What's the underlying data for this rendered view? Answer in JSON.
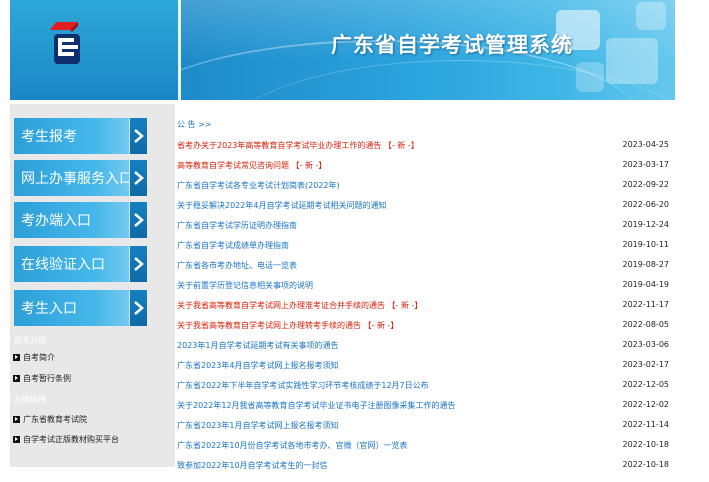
{
  "header": {
    "site_title": "广东省自学考试管理系统"
  },
  "sidebar": {
    "nav": [
      {
        "label": "考生报考"
      },
      {
        "label": "网上办事服务入口"
      },
      {
        "label": "考办端入口"
      },
      {
        "label": "在线验证入口"
      },
      {
        "label": "考生入口"
      }
    ],
    "sections": [
      {
        "heading": "自考介绍",
        "links": [
          "自考简介",
          "自考暂行条例"
        ]
      },
      {
        "heading": "友情链接",
        "links": [
          "广东省教育考试院",
          "自学考试正版教材购买平台"
        ]
      }
    ]
  },
  "notices": {
    "heading": "公 告 >>",
    "items": [
      {
        "title": "省考办关于2023年高等教育自学考试毕业办理工作的通告 【- 新 -】",
        "date": "2023-04-25",
        "highlight": true
      },
      {
        "title": "高等教育自学考试常见咨询问题 【- 新 -】",
        "date": "2023-03-17",
        "highlight": true
      },
      {
        "title": "广东省自学考试各专业考试计划简表(2022年)",
        "date": "2022-09-22",
        "highlight": false
      },
      {
        "title": "关于稳妥解决2022年4月自学考试延期考试相关问题的通知",
        "date": "2022-06-20",
        "highlight": false
      },
      {
        "title": "广东省自学考试学历证明办理指南",
        "date": "2019-12-24",
        "highlight": false
      },
      {
        "title": "广东省自学考试成绩单办理指南",
        "date": "2019-10-11",
        "highlight": false
      },
      {
        "title": "广东省各市考办地址、电话一览表",
        "date": "2019-08-27",
        "highlight": false
      },
      {
        "title": "关于前置学历登记信息相关事项的说明",
        "date": "2019-04-19",
        "highlight": false
      },
      {
        "title": "关于我省高等教育自学考试网上办理准考证合并手续的通告 【- 新 -】",
        "date": "2022-11-17",
        "highlight": true
      },
      {
        "title": "关于我省高等教育自学考试网上办理转考手续的通告 【- 新 -】",
        "date": "2022-08-05",
        "highlight": true
      },
      {
        "title": "2023年1月自学考试延期考试有关事项的通告",
        "date": "2023-03-06",
        "highlight": false
      },
      {
        "title": "广东省2023年4月自学考试网上报名报考须知",
        "date": "2023-02-17",
        "highlight": false
      },
      {
        "title": "广东省2022年下半年自学考试实践性学习环节考核成绩于12月7日公布",
        "date": "2022-12-05",
        "highlight": false
      },
      {
        "title": "关于2022年12月我省高等教育自学考试毕业证书电子注册图像采集工作的通告",
        "date": "2022-12-02",
        "highlight": false
      },
      {
        "title": "广东省2023年1月自学考试网上报名报考须知",
        "date": "2022-11-14",
        "highlight": false
      },
      {
        "title": "广东省2022年10月份自学考试各地市考办、官微（官网）一览表",
        "date": "2022-10-18",
        "highlight": false
      },
      {
        "title": "致参加2022年10月自学考试考生的一封信",
        "date": "2022-10-18",
        "highlight": false
      }
    ]
  },
  "colors": {
    "link": "#1a73c8",
    "hot": "#d81e06",
    "nav_blue": "#2c9fd8",
    "sidebar_bg": "#e8e8e8"
  },
  "icons": [
    "logo-emblem",
    "chevron-right-icon",
    "bullet-arrow-icon"
  ]
}
